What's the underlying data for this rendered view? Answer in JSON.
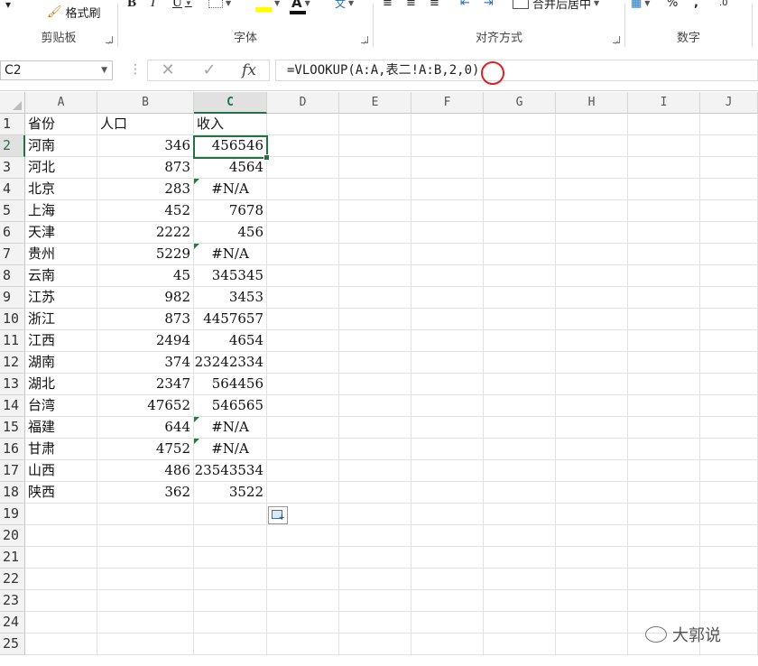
{
  "ribbon": {
    "groups": [
      {
        "label": "剪贴板"
      },
      {
        "label": "字体"
      },
      {
        "label": "对齐方式"
      },
      {
        "label": "数字"
      }
    ],
    "format_painter_label": "格式刷",
    "merge_center_label": "合并后居中",
    "bold_label": "B",
    "italic_label": "I",
    "underline_label": "U",
    "font_color_label": "A",
    "percent_label": "%",
    "comma_label": ","
  },
  "formula_bar": {
    "name_box": "C2",
    "fx_label": "fx",
    "formula": "=VLOOKUP(A:A,表二!A:B,2,0)"
  },
  "sheet": {
    "columns": [
      "A",
      "B",
      "C",
      "D",
      "E",
      "F",
      "G",
      "H",
      "I",
      "J"
    ],
    "selected_column": "C",
    "selected_row": 2,
    "rows": [
      {
        "n": "1",
        "a": "省份",
        "b": "人口",
        "c": "收入"
      },
      {
        "n": "2",
        "a": "河南",
        "b": "346",
        "c": "456546"
      },
      {
        "n": "3",
        "a": "河北",
        "b": "873",
        "c": "4564"
      },
      {
        "n": "4",
        "a": "北京",
        "b": "283",
        "c": "#N/A"
      },
      {
        "n": "5",
        "a": "上海",
        "b": "452",
        "c": "7678"
      },
      {
        "n": "6",
        "a": "天津",
        "b": "2222",
        "c": "456"
      },
      {
        "n": "7",
        "a": "贵州",
        "b": "5229",
        "c": "#N/A"
      },
      {
        "n": "8",
        "a": "云南",
        "b": "45",
        "c": "345345"
      },
      {
        "n": "9",
        "a": "江苏",
        "b": "982",
        "c": "3453"
      },
      {
        "n": "10",
        "a": "浙江",
        "b": "873",
        "c": "4457657"
      },
      {
        "n": "11",
        "a": "江西",
        "b": "2494",
        "c": "4654"
      },
      {
        "n": "12",
        "a": "湖南",
        "b": "374",
        "c": "23242334"
      },
      {
        "n": "13",
        "a": "湖北",
        "b": "2347",
        "c": "564456"
      },
      {
        "n": "14",
        "a": "台湾",
        "b": "47652",
        "c": "546565"
      },
      {
        "n": "15",
        "a": "福建",
        "b": "644",
        "c": "#N/A"
      },
      {
        "n": "16",
        "a": "甘肃",
        "b": "4752",
        "c": "#N/A"
      },
      {
        "n": "17",
        "a": "山西",
        "b": "486",
        "c": "23543534"
      },
      {
        "n": "18",
        "a": "陕西",
        "b": "362",
        "c": "3522"
      },
      {
        "n": "19",
        "a": "",
        "b": "",
        "c": ""
      },
      {
        "n": "20",
        "a": "",
        "b": "",
        "c": ""
      },
      {
        "n": "21",
        "a": "",
        "b": "",
        "c": ""
      },
      {
        "n": "22",
        "a": "",
        "b": "",
        "c": ""
      },
      {
        "n": "23",
        "a": "",
        "b": "",
        "c": ""
      },
      {
        "n": "24",
        "a": "",
        "b": "",
        "c": ""
      },
      {
        "n": "25",
        "a": "",
        "b": "",
        "c": ""
      }
    ]
  },
  "watermark": "大郭说",
  "colors": {
    "accent": "#217346",
    "highlight_circle": "#e02020",
    "error_indicator": "#1e7e34"
  }
}
